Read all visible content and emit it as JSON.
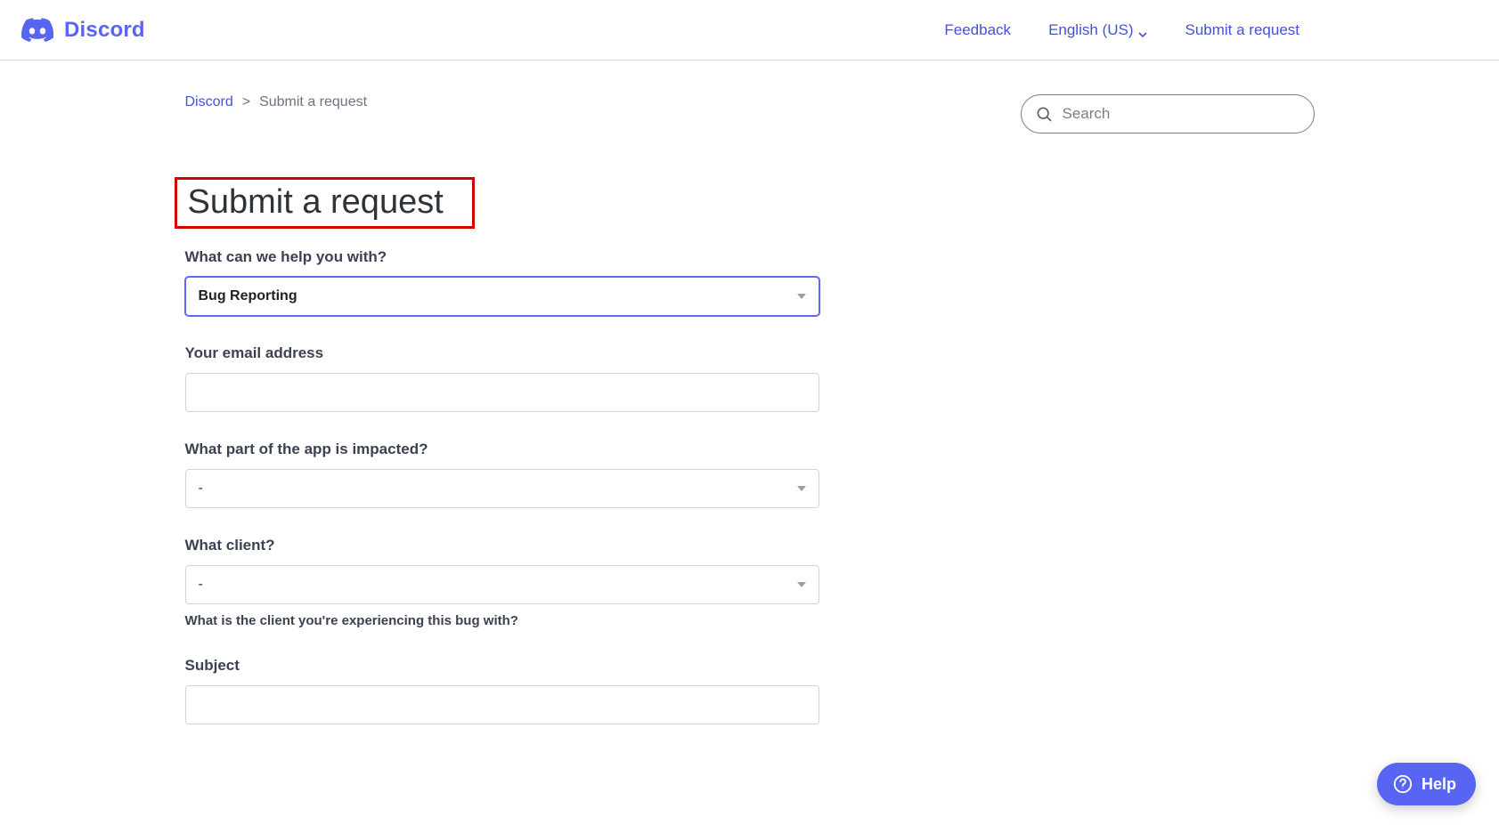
{
  "brand": {
    "name": "Discord"
  },
  "nav": {
    "feedback": "Feedback",
    "language": "English (US)",
    "submit": "Submit a request"
  },
  "breadcrumb": {
    "root": "Discord",
    "sep": ">",
    "current": "Submit a request"
  },
  "search": {
    "placeholder": "Search",
    "value": ""
  },
  "page": {
    "title": "Submit a request"
  },
  "form": {
    "help_topic": {
      "label": "What can we help you with?",
      "value": "Bug Reporting"
    },
    "email": {
      "label": "Your email address",
      "value": ""
    },
    "impacted_part": {
      "label": "What part of the app is impacted?",
      "value": "-"
    },
    "client": {
      "label": "What client?",
      "value": "-",
      "help": "What is the client you're experiencing this bug with?"
    },
    "subject": {
      "label": "Subject",
      "value": ""
    }
  },
  "help_fab": {
    "label": "Help"
  }
}
